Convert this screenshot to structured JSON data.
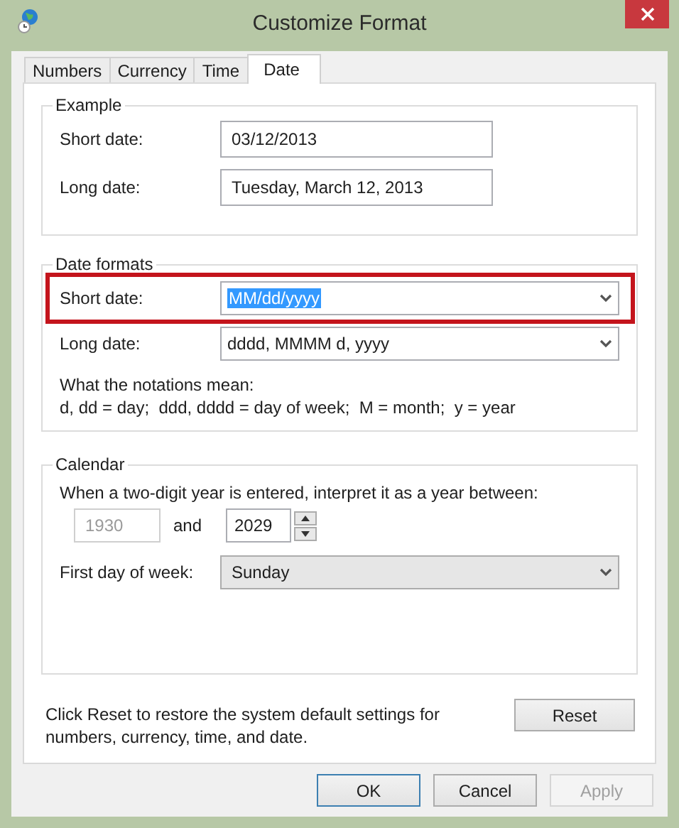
{
  "window": {
    "title": "Customize Format"
  },
  "tabs": [
    {
      "label": "Numbers",
      "selected": false
    },
    {
      "label": "Currency",
      "selected": false
    },
    {
      "label": "Time",
      "selected": false
    },
    {
      "label": "Date",
      "selected": true
    }
  ],
  "example": {
    "title": "Example",
    "rows": [
      {
        "label": "Short date:",
        "value": "03/12/2013"
      },
      {
        "label": "Long date:",
        "value": "Tuesday, March 12, 2013"
      }
    ]
  },
  "date_formats": {
    "title": "Date formats",
    "rows": [
      {
        "label": "Short date:",
        "value": "MM/dd/yyyy",
        "text_selected": true,
        "highlighted": true
      },
      {
        "label": "Long date:",
        "value": "dddd, MMMM d, yyyy",
        "text_selected": false,
        "highlighted": false
      }
    ],
    "notes": [
      "What the notations mean:",
      "d, dd = day;  ddd, dddd = day of week;  M = month;  y = year"
    ]
  },
  "calendar": {
    "title": "Calendar",
    "prompt": "When a two-digit year is entered, interpret it as a year between:",
    "from": {
      "value": "1930",
      "disabled": true
    },
    "and_label": "and",
    "to": {
      "value": "2029",
      "disabled": false
    },
    "first_day": {
      "label": "First day of week:",
      "value": "Sunday"
    }
  },
  "reset": {
    "text": "Click Reset to restore the system default settings for numbers, currency, time, and date.",
    "button": "Reset"
  },
  "buttons": [
    {
      "label": "OK",
      "default": true,
      "disabled": false
    },
    {
      "label": "Cancel",
      "default": false,
      "disabled": false
    },
    {
      "label": "Apply",
      "default": false,
      "disabled": true
    }
  ]
}
